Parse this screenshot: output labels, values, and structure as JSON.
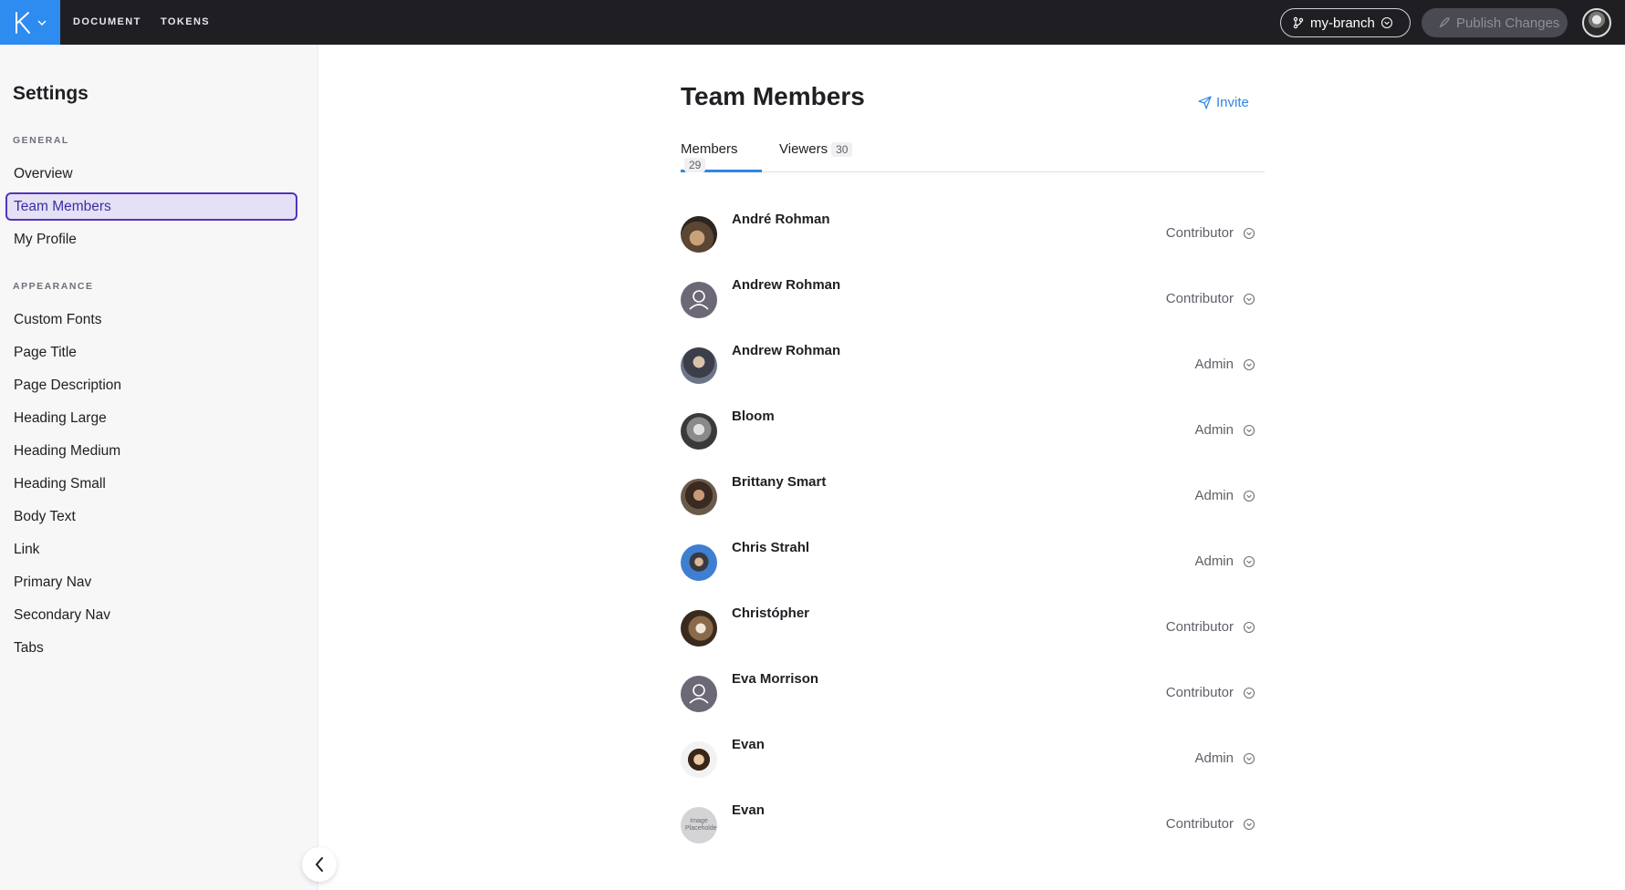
{
  "topbar": {
    "nav": [
      {
        "label": "DOCUMENT"
      },
      {
        "label": "TOKENS"
      }
    ],
    "branch_label": "my-branch",
    "publish_label": "Publish Changes"
  },
  "sidebar": {
    "title": "Settings",
    "groups": [
      {
        "label": "GENERAL",
        "items": [
          {
            "label": "Overview"
          },
          {
            "label": "Team Members",
            "active": true
          },
          {
            "label": "My Profile"
          }
        ]
      },
      {
        "label": "APPEARANCE",
        "items": [
          {
            "label": "Custom Fonts"
          },
          {
            "label": "Page Title"
          },
          {
            "label": "Page Description"
          },
          {
            "label": "Heading Large"
          },
          {
            "label": "Heading Medium"
          },
          {
            "label": "Heading Small"
          },
          {
            "label": "Body Text"
          },
          {
            "label": "Link"
          },
          {
            "label": "Primary Nav"
          },
          {
            "label": "Secondary Nav"
          },
          {
            "label": "Tabs"
          }
        ]
      }
    ]
  },
  "main": {
    "title": "Team Members",
    "invite_label": "Invite",
    "tabs": [
      {
        "label": "Members",
        "count": "29",
        "active": true
      },
      {
        "label": "Viewers",
        "count": "30",
        "active": false
      }
    ],
    "members": [
      {
        "name": "André Rohman",
        "role": "Contributor",
        "avatar": "photo"
      },
      {
        "name": "Andrew Rohman",
        "role": "Contributor",
        "avatar": "placeholder"
      },
      {
        "name": "Andrew Rohman",
        "role": "Admin",
        "avatar": "photo"
      },
      {
        "name": "Bloom",
        "role": "Admin",
        "avatar": "photo"
      },
      {
        "name": "Brittany Smart",
        "role": "Admin",
        "avatar": "photo"
      },
      {
        "name": "Chris Strahl",
        "role": "Admin",
        "avatar": "photo"
      },
      {
        "name": "Christópher",
        "role": "Contributor",
        "avatar": "photo"
      },
      {
        "name": "Eva Morrison",
        "role": "Contributor",
        "avatar": "placeholder"
      },
      {
        "name": "Evan",
        "role": "Admin",
        "avatar": "photo"
      },
      {
        "name": "Evan",
        "role": "Contributor",
        "avatar": "image-placeholder",
        "avatar_text": "Image Placeholder"
      }
    ]
  },
  "colors": {
    "topbar_bg": "#1f1f23",
    "logo_bg": "#2e8bf0",
    "accent_blue": "#2f86e6",
    "active_item_bg": "#e4e0f6",
    "active_item_border": "#5535b4"
  }
}
